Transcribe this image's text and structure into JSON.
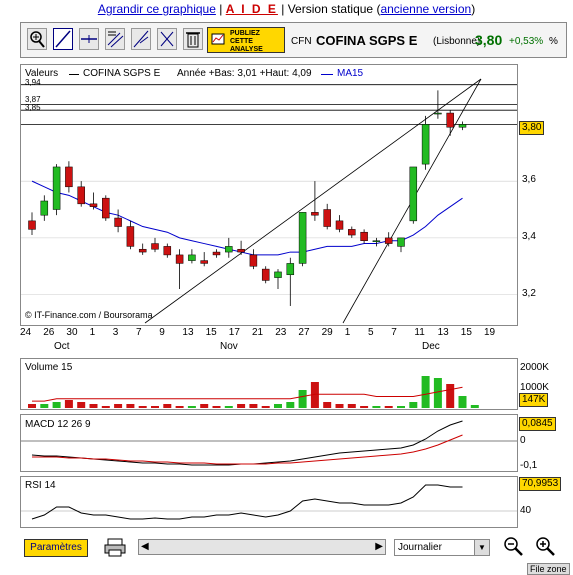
{
  "links": {
    "enlarge": "Agrandir ce graphique",
    "help": "A I D E",
    "static_prefix": "Version statique",
    "old_version": "ancienne version"
  },
  "toolbar": {
    "promo_lines": [
      "PUBLIEZ",
      "CETTE",
      "ANALYSE"
    ],
    "tools": [
      "zoom-in-icon",
      "line-tool-icon",
      "horizontal-line-icon",
      "channel-icon",
      "fibonacci-icon",
      "draw-icon",
      "trash-icon"
    ]
  },
  "quote": {
    "code": "CFN",
    "name": "COFINA SGPS E",
    "exchange": "(Lisbonne)",
    "price": "3,80",
    "change": "+0,53%",
    "pct": "%"
  },
  "main_chart": {
    "legend_label": "Valeurs",
    "legend_title": "COFINA SGPS E",
    "legend_year": "Année +Bas: 3,01 +Haut: 4,09",
    "legend_ma": "MA15",
    "last_price_badge": "3,80",
    "watermark": "© IT-Finance.com / Boursorama",
    "price_levels": [
      "3,94",
      "3,87",
      "3,85"
    ]
  },
  "volume_panel": {
    "label": "Volume 15",
    "badge": "147K"
  },
  "macd_panel": {
    "label": "MACD 12 26 9",
    "badge": "0,0845"
  },
  "rsi_panel": {
    "label": "RSI 14",
    "badge": "70,9953"
  },
  "bottom": {
    "params_label": "Paramètres",
    "period": "Journalier",
    "filezone": "File zone"
  },
  "colors": {
    "up": "#22bb22",
    "down": "#cc1111",
    "ma": "#0000cc",
    "badge": "#ffd700"
  },
  "chart_data": {
    "type": "candlestick",
    "title": "COFINA SGPS E",
    "x_ticks": [
      "24",
      "26",
      "30",
      "1",
      "3",
      "7",
      "9",
      "13",
      "15",
      "17",
      "21",
      "23",
      "27",
      "29",
      "1",
      "5",
      "7",
      "11",
      "13",
      "15",
      "19"
    ],
    "month_labels": [
      "Oct",
      "Nov",
      "Dec"
    ],
    "y_ticks": [
      "3,2",
      "3,4",
      "3,6",
      "3,80"
    ],
    "ylim": [
      3.1,
      3.96
    ],
    "candles": [
      {
        "o": 3.46,
        "h": 3.49,
        "l": 3.41,
        "c": 3.43
      },
      {
        "o": 3.48,
        "h": 3.55,
        "l": 3.46,
        "c": 3.53
      },
      {
        "o": 3.5,
        "h": 3.66,
        "l": 3.48,
        "c": 3.65
      },
      {
        "o": 3.65,
        "h": 3.67,
        "l": 3.56,
        "c": 3.58
      },
      {
        "o": 3.58,
        "h": 3.6,
        "l": 3.51,
        "c": 3.52
      },
      {
        "o": 3.52,
        "h": 3.56,
        "l": 3.5,
        "c": 3.51
      },
      {
        "o": 3.54,
        "h": 3.55,
        "l": 3.46,
        "c": 3.47
      },
      {
        "o": 3.47,
        "h": 3.5,
        "l": 3.42,
        "c": 3.44
      },
      {
        "o": 3.44,
        "h": 3.46,
        "l": 3.36,
        "c": 3.37
      },
      {
        "o": 3.36,
        "h": 3.38,
        "l": 3.34,
        "c": 3.35
      },
      {
        "o": 3.38,
        "h": 3.4,
        "l": 3.35,
        "c": 3.36
      },
      {
        "o": 3.37,
        "h": 3.38,
        "l": 3.33,
        "c": 3.34
      },
      {
        "o": 3.34,
        "h": 3.36,
        "l": 3.22,
        "c": 3.31
      },
      {
        "o": 3.32,
        "h": 3.36,
        "l": 3.31,
        "c": 3.34
      },
      {
        "o": 3.32,
        "h": 3.35,
        "l": 3.3,
        "c": 3.31
      },
      {
        "o": 3.35,
        "h": 3.36,
        "l": 3.33,
        "c": 3.34
      },
      {
        "o": 3.35,
        "h": 3.4,
        "l": 3.33,
        "c": 3.37
      },
      {
        "o": 3.36,
        "h": 3.39,
        "l": 3.34,
        "c": 3.35
      },
      {
        "o": 3.34,
        "h": 3.36,
        "l": 3.29,
        "c": 3.3
      },
      {
        "o": 3.29,
        "h": 3.3,
        "l": 3.24,
        "c": 3.25
      },
      {
        "o": 3.26,
        "h": 3.29,
        "l": 3.22,
        "c": 3.28
      },
      {
        "o": 3.27,
        "h": 3.33,
        "l": 3.16,
        "c": 3.31
      },
      {
        "o": 3.31,
        "h": 3.49,
        "l": 3.3,
        "c": 3.49
      },
      {
        "o": 3.49,
        "h": 3.6,
        "l": 3.46,
        "c": 3.48
      },
      {
        "o": 3.5,
        "h": 3.52,
        "l": 3.43,
        "c": 3.44
      },
      {
        "o": 3.46,
        "h": 3.48,
        "l": 3.42,
        "c": 3.43
      },
      {
        "o": 3.43,
        "h": 3.44,
        "l": 3.4,
        "c": 3.41
      },
      {
        "o": 3.42,
        "h": 3.43,
        "l": 3.38,
        "c": 3.39
      },
      {
        "o": 3.39,
        "h": 3.4,
        "l": 3.37,
        "c": 3.39
      },
      {
        "o": 3.4,
        "h": 3.42,
        "l": 3.37,
        "c": 3.38
      },
      {
        "o": 3.37,
        "h": 3.4,
        "l": 3.35,
        "c": 3.4
      },
      {
        "o": 3.46,
        "h": 3.65,
        "l": 3.45,
        "c": 3.65
      },
      {
        "o": 3.66,
        "h": 3.83,
        "l": 3.64,
        "c": 3.8
      },
      {
        "o": 3.84,
        "h": 3.92,
        "l": 3.82,
        "c": 3.84
      },
      {
        "o": 3.84,
        "h": 3.85,
        "l": 3.76,
        "c": 3.79
      },
      {
        "o": 3.79,
        "h": 3.81,
        "l": 3.78,
        "c": 3.8
      }
    ],
    "ma15": [
      3.6,
      3.58,
      3.56,
      3.55,
      3.53,
      3.51,
      3.49,
      3.48,
      3.46,
      3.44,
      3.43,
      3.42,
      3.4,
      3.39,
      3.38,
      3.37,
      3.36,
      3.35,
      3.34,
      3.34,
      3.34,
      3.35,
      3.35,
      3.36,
      3.37,
      3.37,
      3.37,
      3.38,
      3.38,
      3.39,
      3.39,
      3.41,
      3.44,
      3.48,
      3.51,
      3.54
    ],
    "volume": [
      0.2,
      0.2,
      0.3,
      0.4,
      0.3,
      0.2,
      0.1,
      0.2,
      0.2,
      0.1,
      0.1,
      0.2,
      0.1,
      0.1,
      0.2,
      0.1,
      0.1,
      0.2,
      0.2,
      0.1,
      0.2,
      0.3,
      0.9,
      1.3,
      0.3,
      0.2,
      0.2,
      0.1,
      0.1,
      0.1,
      0.1,
      0.3,
      1.6,
      1.5,
      1.2,
      0.6,
      0.15
    ],
    "volume_ticks": [
      "2000K",
      "1000K"
    ],
    "macd_ticks": [
      "0",
      "-0,1"
    ],
    "rsi_ticks": [
      "40"
    ]
  }
}
